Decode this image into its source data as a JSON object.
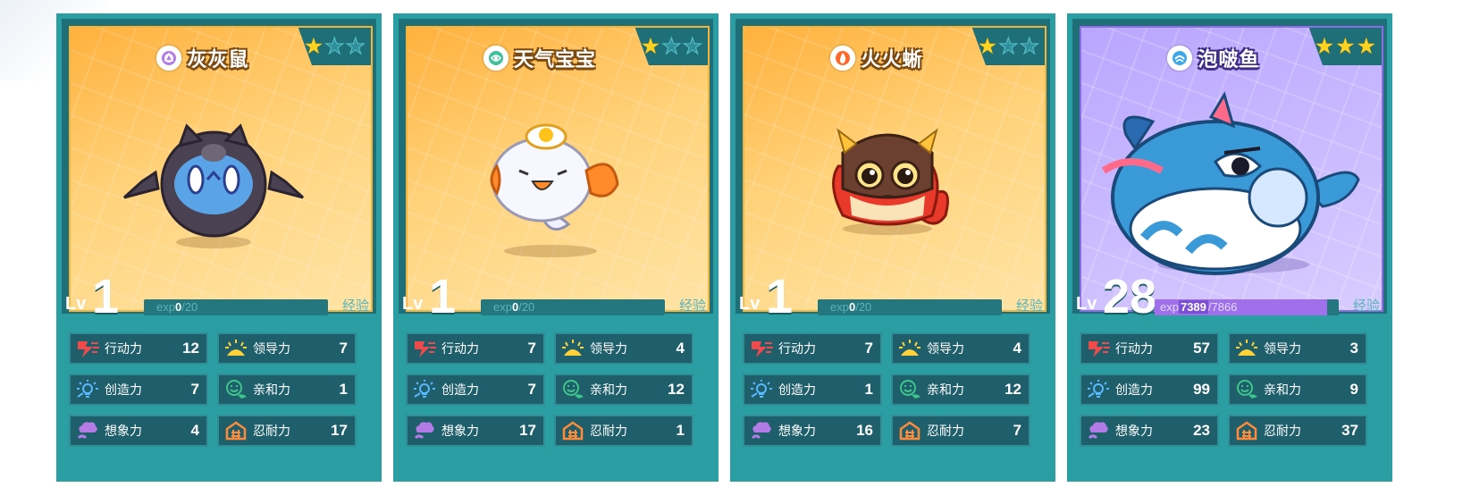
{
  "colors": {
    "card_frame": "#2b9ea3",
    "card_dark": "#1f6f78",
    "art_orange": "#ffc35a",
    "art_purple": "#c2b0ff",
    "star_on": "#ffd21f",
    "exp_fill": "#a070ea"
  },
  "cards": [
    {
      "name": "灰灰鼠",
      "element_icon": "shadow-element-icon",
      "element_color": "#b37be6",
      "stars_filled": 1,
      "stars_total": 3,
      "level_label": "Lv",
      "level": "1",
      "exp_prefix": "exp",
      "exp_current": "0",
      "exp_max": "/20",
      "exp_fraction": 0,
      "exp_tag": "经验",
      "stats": [
        {
          "icon": "action-icon",
          "label": "行动力",
          "value": "12"
        },
        {
          "icon": "leadership-icon",
          "label": "领导力",
          "value": "7"
        },
        {
          "icon": "creativity-icon",
          "label": "创造力",
          "value": "7"
        },
        {
          "icon": "affinity-icon",
          "label": "亲和力",
          "value": "1"
        },
        {
          "icon": "imagination-icon",
          "label": "想象力",
          "value": "4"
        },
        {
          "icon": "endurance-icon",
          "label": "忍耐力",
          "value": "17"
        }
      ]
    },
    {
      "name": "天气宝宝",
      "element_icon": "weather-element-icon",
      "element_color": "#3fbf9a",
      "stars_filled": 1,
      "stars_total": 3,
      "level_label": "Lv",
      "level": "1",
      "exp_prefix": "exp",
      "exp_current": "0",
      "exp_max": "/20",
      "exp_fraction": 0,
      "exp_tag": "经验",
      "stats": [
        {
          "icon": "action-icon",
          "label": "行动力",
          "value": "7"
        },
        {
          "icon": "leadership-icon",
          "label": "领导力",
          "value": "4"
        },
        {
          "icon": "creativity-icon",
          "label": "创造力",
          "value": "7"
        },
        {
          "icon": "affinity-icon",
          "label": "亲和力",
          "value": "12"
        },
        {
          "icon": "imagination-icon",
          "label": "想象力",
          "value": "17"
        },
        {
          "icon": "endurance-icon",
          "label": "忍耐力",
          "value": "1"
        }
      ]
    },
    {
      "name": "火火蜥",
      "element_icon": "fire-element-icon",
      "element_color": "#ff6a2a",
      "stars_filled": 1,
      "stars_total": 3,
      "level_label": "Lv",
      "level": "1",
      "exp_prefix": "exp",
      "exp_current": "0",
      "exp_max": "/20",
      "exp_fraction": 0,
      "exp_tag": "经验",
      "stats": [
        {
          "icon": "action-icon",
          "label": "行动力",
          "value": "7"
        },
        {
          "icon": "leadership-icon",
          "label": "领导力",
          "value": "4"
        },
        {
          "icon": "creativity-icon",
          "label": "创造力",
          "value": "1"
        },
        {
          "icon": "affinity-icon",
          "label": "亲和力",
          "value": "12"
        },
        {
          "icon": "imagination-icon",
          "label": "想象力",
          "value": "16"
        },
        {
          "icon": "endurance-icon",
          "label": "忍耐力",
          "value": "7"
        }
      ]
    },
    {
      "name": "泡啵鱼",
      "element_icon": "water-element-icon",
      "element_color": "#3fa8e6",
      "stars_filled": 3,
      "stars_total": 3,
      "level_label": "Lv",
      "level": "28",
      "exp_prefix": "exp",
      "exp_current": "7389",
      "exp_max": "/7866",
      "exp_fraction": 0.939,
      "exp_tag": "经验",
      "stats": [
        {
          "icon": "action-icon",
          "label": "行动力",
          "value": "57"
        },
        {
          "icon": "leadership-icon",
          "label": "领导力",
          "value": "3"
        },
        {
          "icon": "creativity-icon",
          "label": "创造力",
          "value": "99"
        },
        {
          "icon": "affinity-icon",
          "label": "亲和力",
          "value": "9"
        },
        {
          "icon": "imagination-icon",
          "label": "想象力",
          "value": "23"
        },
        {
          "icon": "endurance-icon",
          "label": "忍耐力",
          "value": "37"
        }
      ]
    }
  ]
}
